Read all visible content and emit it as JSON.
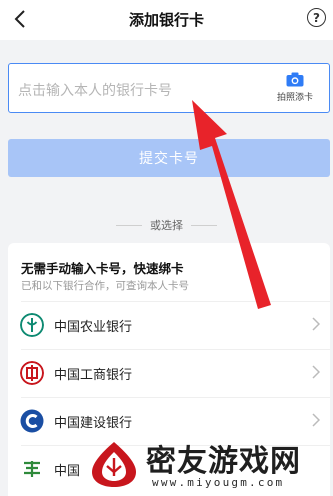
{
  "header": {
    "title": "添加银行卡",
    "help_symbol": "?"
  },
  "card_input": {
    "placeholder": "点击输入本人的银行卡号",
    "camera_label": "拍照添卡"
  },
  "submit": {
    "label": "提交卡号"
  },
  "divider": {
    "label": "或选择"
  },
  "quick_bind": {
    "title": "无需手动输入卡号，快速绑卡",
    "subtitle": "已和以下银行合作，可查询本人卡号",
    "banks": [
      {
        "name": "中国农业银行",
        "icon": "abc-bank-logo-icon",
        "color": "#0e8a72"
      },
      {
        "name": "中国工商银行",
        "icon": "icbc-bank-logo-icon",
        "color": "#c8161d"
      },
      {
        "name": "中国建设银行",
        "icon": "ccb-bank-logo-icon",
        "color": "#1a4ea3"
      },
      {
        "name": "中国",
        "icon": "bank-logo-icon",
        "color": "#2f8a3b"
      }
    ]
  },
  "watermark": {
    "text": "密友游戏网",
    "url": "www.miyougm.com"
  },
  "colors": {
    "accent": "#4a8af4",
    "button_disabled": "#a8c5f7",
    "arrow": "#e8232a"
  }
}
